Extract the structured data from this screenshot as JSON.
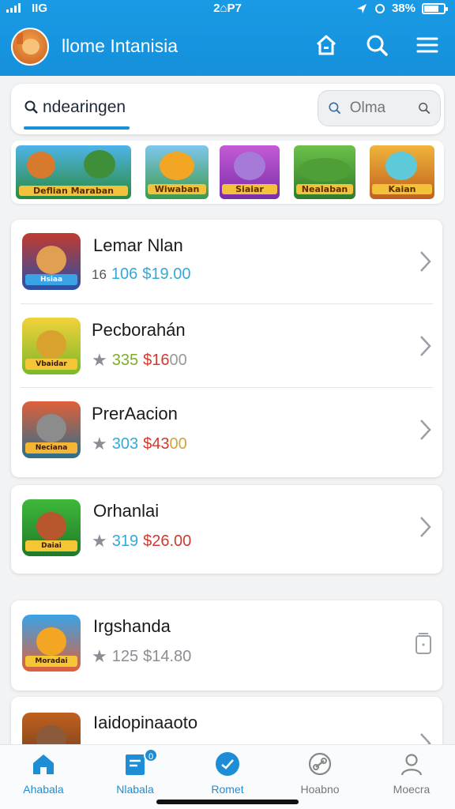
{
  "status_bar": {
    "network": "IIG",
    "time": "2⌂P7",
    "battery": "38%"
  },
  "header": {
    "title": "llome Intanisia",
    "icons": [
      "home-icon",
      "search-icon",
      "menu-icon"
    ]
  },
  "search": {
    "tab_label": "ndearingen",
    "placeholder": "Olma"
  },
  "featured": [
    {
      "label": "Deflian Maraban"
    },
    {
      "label": "Wiwaban"
    },
    {
      "label": "Siaiar"
    },
    {
      "label": "Nealaban"
    },
    {
      "label": "Kaian"
    }
  ],
  "games": [
    {
      "name": "Lemar Nlan",
      "rating": "16",
      "count": "106",
      "price": "$19.00",
      "count_color": "#34a9d6",
      "price_color": "#34a9d6",
      "badge": "Hsiaa"
    },
    {
      "name": "Pecborahán",
      "rating": "",
      "count": "335",
      "price": "$16",
      "price_tail": "00",
      "count_color": "#7cae2a",
      "price_color": "#d0392f",
      "badge": "Vbaidar"
    },
    {
      "name": "PrerAacion",
      "rating": "",
      "count": "303",
      "price": "$43",
      "price_tail": "00",
      "count_color": "#34a9d6",
      "price_color": "#d0392f",
      "badge": "Neciana"
    },
    {
      "name": "Orhanlai",
      "rating": "",
      "count": "319",
      "price": "$26.00",
      "count_color": "#34a9d6",
      "price_color": "#d0392f",
      "badge": "Daiai"
    },
    {
      "name": "Irgshanda",
      "rating": "",
      "count": "125",
      "price": "$14.80",
      "count_color": "#8a8e94",
      "price_color": "#8a8e94",
      "badge": "Moradai"
    },
    {
      "name": "Iaidopinaaoto",
      "rating": "",
      "count": "",
      "price": "",
      "count_color": "#8a8e94",
      "price_color": "#8a8e94",
      "badge": ""
    }
  ],
  "nav": [
    {
      "label": "Ahabala",
      "icon": "home-icon"
    },
    {
      "label": "Nlabala",
      "icon": "clipboard-icon",
      "badge": "0"
    },
    {
      "label": "Romet",
      "icon": "check-circle-icon"
    },
    {
      "label": "Hoabno",
      "icon": "link-icon"
    },
    {
      "label": "Moecra",
      "icon": "person-icon"
    }
  ],
  "colors": {
    "accent": "#1a9ae4",
    "active_nav": "#1d8ed6"
  }
}
